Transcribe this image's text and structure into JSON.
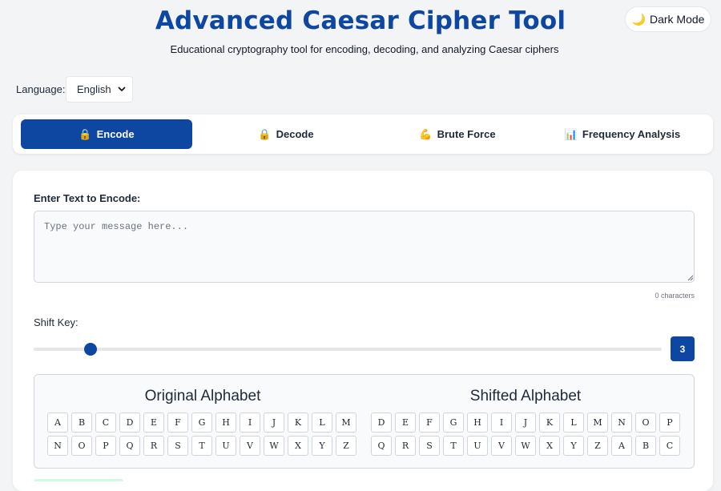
{
  "header": {
    "title": "Advanced Caesar Cipher Tool",
    "subtitle": "Educational cryptography tool for encoding, decoding, and analyzing Caesar ciphers",
    "dark_mode_label": "Dark Mode",
    "dark_mode_icon": "moon-icon"
  },
  "language": {
    "label": "Language:",
    "selected": "English"
  },
  "tabs": [
    {
      "label": "Encode",
      "icon": "lock-icon",
      "active": true
    },
    {
      "label": "Decode",
      "icon": "lock-icon",
      "active": false
    },
    {
      "label": "Brute Force",
      "icon": "flexed-biceps-icon",
      "active": false
    },
    {
      "label": "Frequency Analysis",
      "icon": "bar-chart-icon",
      "active": false
    }
  ],
  "encode": {
    "input_label": "Enter Text to Encode:",
    "placeholder": "Type your message here...",
    "char_count": "0 characters",
    "shift_label": "Shift Key:",
    "shift_value": "3",
    "shift_min": 1,
    "shift_max": 25
  },
  "alphabets": {
    "original_heading": "Original Alphabet",
    "shifted_heading": "Shifted Alphabet",
    "original": [
      "A",
      "B",
      "C",
      "D",
      "E",
      "F",
      "G",
      "H",
      "I",
      "J",
      "K",
      "L",
      "M",
      "N",
      "O",
      "P",
      "Q",
      "R",
      "S",
      "T",
      "U",
      "V",
      "W",
      "X",
      "Y",
      "Z"
    ],
    "shifted": [
      "D",
      "E",
      "F",
      "G",
      "H",
      "I",
      "J",
      "K",
      "L",
      "M",
      "N",
      "O",
      "P",
      "Q",
      "R",
      "S",
      "T",
      "U",
      "V",
      "W",
      "X",
      "Y",
      "Z",
      "A",
      "B",
      "C"
    ]
  },
  "colors": {
    "primary": "#0d47a1",
    "background": "#f3f4f6"
  }
}
